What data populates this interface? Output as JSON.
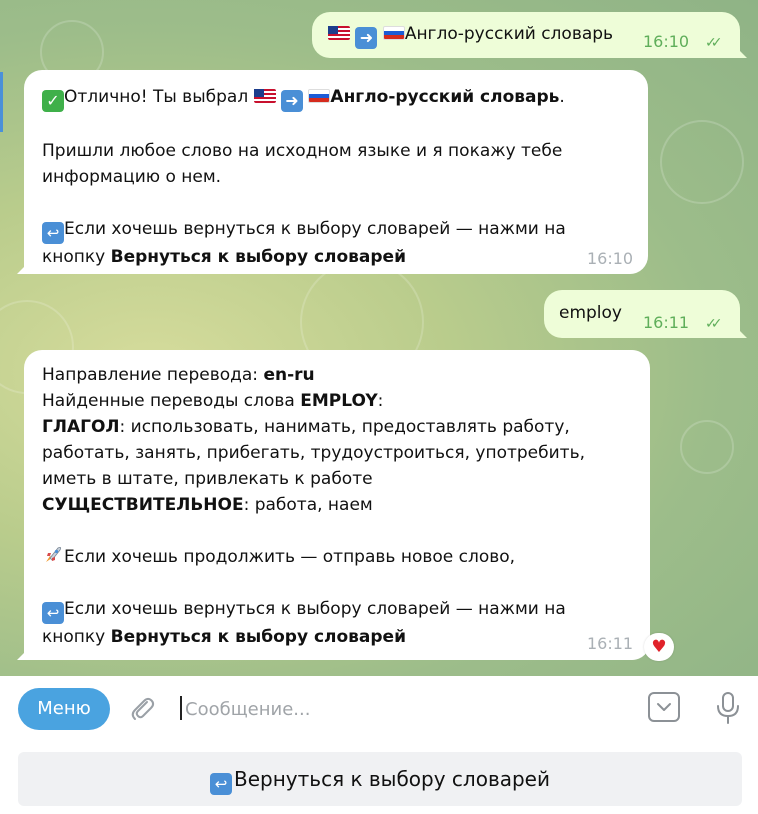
{
  "messages": [
    {
      "direction": "out",
      "text": "Англо-русский словарь",
      "time": "16:10",
      "status": "read"
    },
    {
      "direction": "in",
      "line1_prefix": "Отлично! Ты выбрал ",
      "line1_bold": "Англо-русский словарь",
      "line1_suffix": ".",
      "para2": "Пришли любое слово на исходном языке и я покажу тебе информацию о нем.",
      "para3_prefix": "Если хочешь вернуться к выбору словарей — нажми на кнопку ",
      "para3_bold": "Вернуться к выбору словарей",
      "time": "16:10"
    },
    {
      "direction": "out",
      "text": "employ",
      "time": "16:11",
      "status": "read"
    },
    {
      "direction": "in",
      "dir_label": "Направление перевода: ",
      "dir_value": "en-ru",
      "found_label": "Найденные переводы слова ",
      "found_word": "EMPLOY",
      "found_colon": ":",
      "verb_label": "ГЛАГОЛ",
      "verb_text": ": использовать, нанимать, предоставлять работу, работать, занять, прибегать, трудоустроиться, употребить, иметь в штате, привлекать к работе",
      "noun_label": "СУЩЕСТВИТЕЛЬНОЕ",
      "noun_text": ": работа, наем",
      "continue_text": "Если хочешь продолжить — отправь новое слово,",
      "return_prefix": "Если хочешь вернуться к выбору словарей — нажми на кнопку ",
      "return_bold": "Вернуться к выбору словарей",
      "time": "16:11",
      "reaction": "heart"
    }
  ],
  "composer": {
    "menu_label": "Меню",
    "placeholder": "Сообщение..."
  },
  "keyboard": {
    "button_label": "Вернуться к выбору словарей"
  },
  "colors": {
    "outgoing_bubble": "#eefdd8",
    "incoming_bubble": "#ffffff",
    "accent": "#4aa3e0",
    "read_ticks": "#5fae5a"
  },
  "icons": {
    "attach": "paperclip-icon",
    "sticker": "sticker-icon",
    "voice": "microphone-icon",
    "reaction": "heart-icon"
  }
}
